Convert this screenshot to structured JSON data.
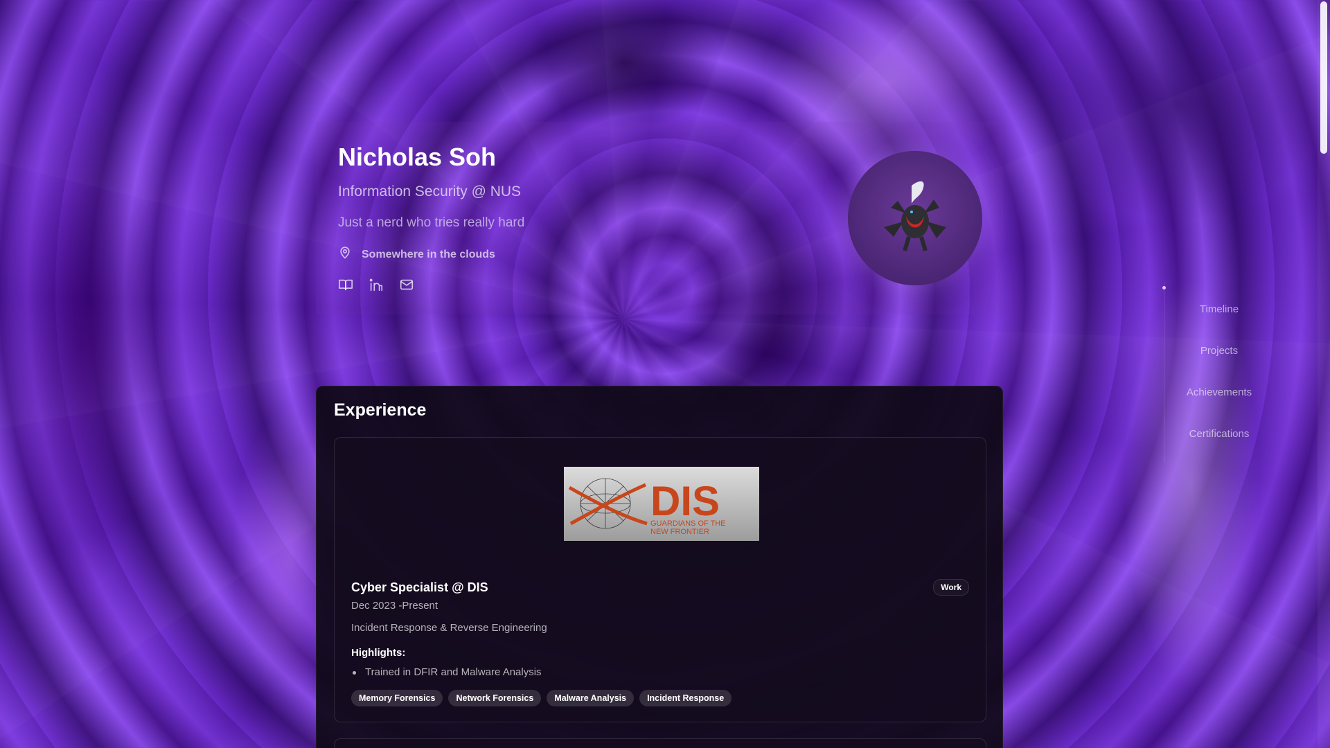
{
  "profile": {
    "name": "Nicholas Soh",
    "subtitle": "Information Security @ NUS",
    "tagline": "Just a nerd who tries really hard",
    "location": "Somewhere in the clouds"
  },
  "socials": [
    {
      "icon": "book-icon"
    },
    {
      "icon": "linkedin-icon"
    },
    {
      "icon": "mail-icon"
    }
  ],
  "sidenav": {
    "items": [
      "Timeline",
      "Projects",
      "Achievements",
      "Certifications"
    ]
  },
  "experience": {
    "title": "Experience",
    "cards": [
      {
        "logo_text": "DIS",
        "logo_caption_1": "GUARDIANS OF THE",
        "logo_caption_2": "NEW FRONTIER",
        "role": "Cyber Specialist @ DIS",
        "badge": "Work",
        "dates": "Dec 2023 -Present",
        "description": "Incident Response & Reverse Engineering",
        "highlights_label": "Highlights:",
        "highlights": [
          "Trained in DFIR and Malware Analysis"
        ],
        "tags": [
          "Memory Forensics",
          "Network Forensics",
          "Malware Analysis",
          "Incident Response"
        ]
      }
    ]
  },
  "colors": {
    "background": "#5a1fb0",
    "panel": "#100a18",
    "accent_logo": "#c8461b"
  }
}
